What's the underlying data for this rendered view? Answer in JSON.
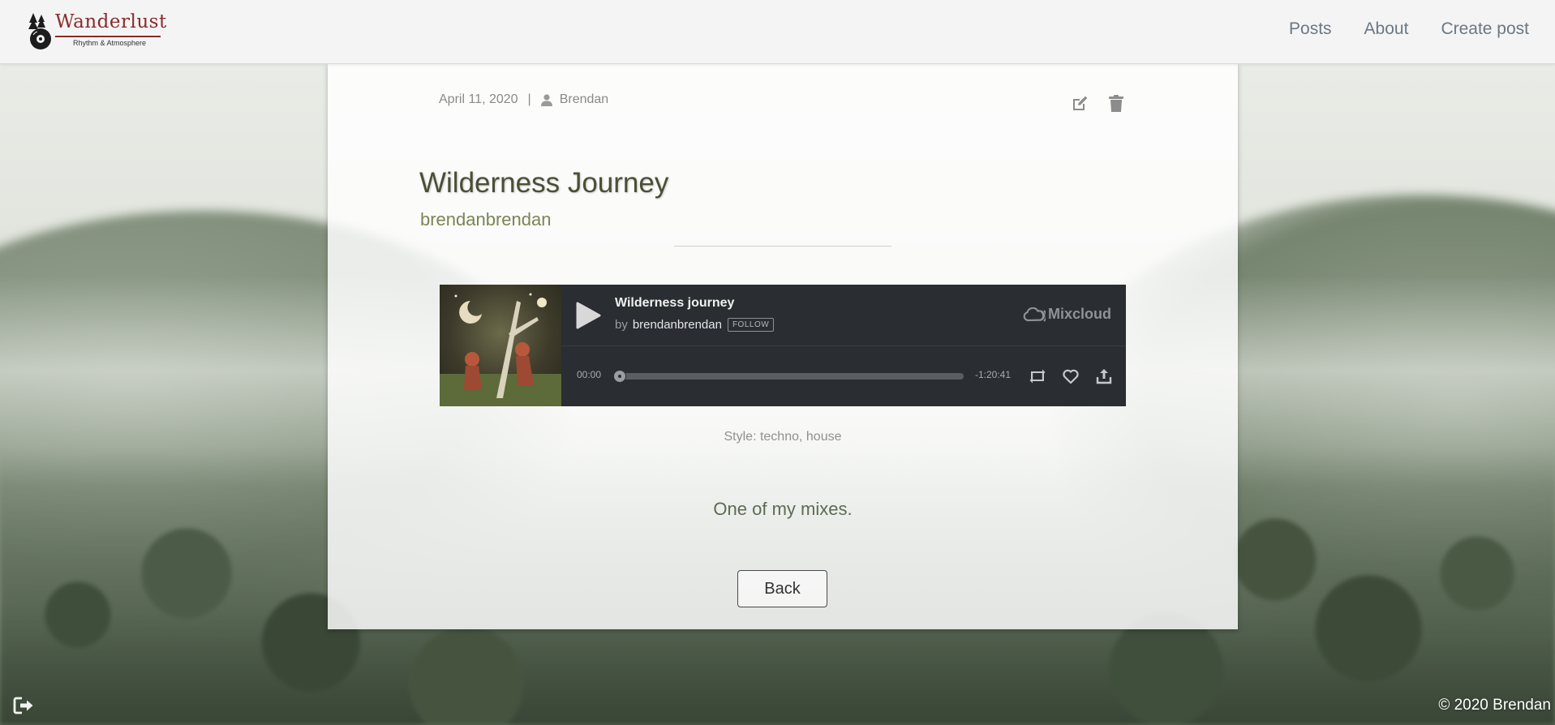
{
  "brand": {
    "name": "Wanderlust",
    "tagline": "Rhythm & Atmosphere",
    "color": "#8a2b2b"
  },
  "nav": {
    "items": [
      {
        "label": "Posts"
      },
      {
        "label": "About"
      },
      {
        "label": "Create post"
      }
    ]
  },
  "post": {
    "date": "April 11, 2020",
    "separator": "|",
    "author": "Brendan",
    "title": "Wilderness Journey",
    "subtitle": "brendanbrendan",
    "style": "Style: techno, house",
    "description": "One of my mixes.",
    "back_label": "Back",
    "actions": {
      "edit_icon": "edit-icon",
      "delete_icon": "trash-icon"
    }
  },
  "player": {
    "track_title": "Wilderness journey",
    "by_label": "by",
    "artist": "brendanbrendan",
    "follow_label": "FOLLOW",
    "provider": "Mixcloud",
    "time_elapsed": "00:00",
    "time_remaining": "-1:20:41",
    "progress_fraction": 0,
    "background_color": "#2a2d31"
  },
  "footer": {
    "copyright": "© 2020 Brendan",
    "logout_icon": "sign-out-icon"
  }
}
